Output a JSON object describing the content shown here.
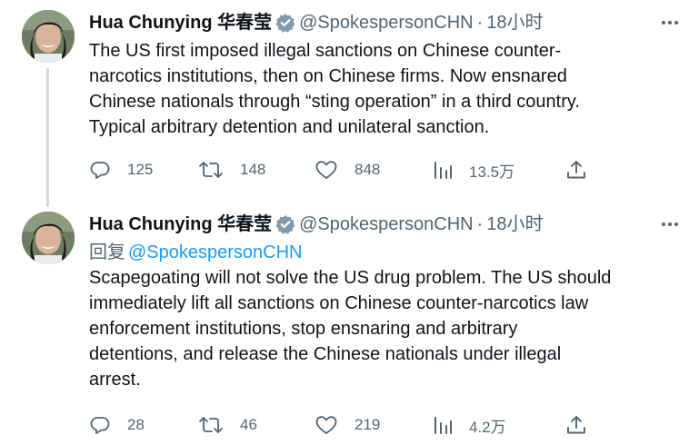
{
  "tweets": [
    {
      "author": {
        "display_name": "Hua Chunying 华春莹",
        "handle": "@SpokespersonCHN",
        "verified": true
      },
      "time": "18小时",
      "text_lines": [
        "The US first imposed illegal sanctions on Chinese counter-",
        "narcotics institutions, then on Chinese firms. Now ensnared",
        "Chinese nationals through “sting operation” in a third country.",
        "Typical arbitrary detention and unilateral sanction."
      ],
      "stats": {
        "replies": "125",
        "retweets": "148",
        "likes": "848",
        "views": "13.5万"
      },
      "icons": [
        "reply-icon",
        "retweet-icon",
        "like-icon",
        "views-icon",
        "share-icon",
        "more-icon",
        "verified-icon"
      ]
    },
    {
      "author": {
        "display_name": "Hua Chunying 华春莹",
        "handle": "@SpokespersonCHN",
        "verified": true
      },
      "time": "18小时",
      "reply_prefix": "回复",
      "reply_mention": "@SpokespersonCHN",
      "text_lines": [
        "Scapegoating will not solve the US drug problem. The US should",
        "immediately lift all sanctions on Chinese counter-narcotics law",
        "enforcement institutions, stop ensnaring and arbitrary",
        "detentions, and release the Chinese nationals under illegal",
        "arrest."
      ],
      "stats": {
        "replies": "28",
        "retweets": "46",
        "likes": "219",
        "views": "4.2万"
      }
    }
  ],
  "separator": "·",
  "colors": {
    "text": "#0f1419",
    "secondary": "#536471",
    "link": "#1d9bf0",
    "verified": "#829aab",
    "thread_line": "#cfd9de"
  }
}
